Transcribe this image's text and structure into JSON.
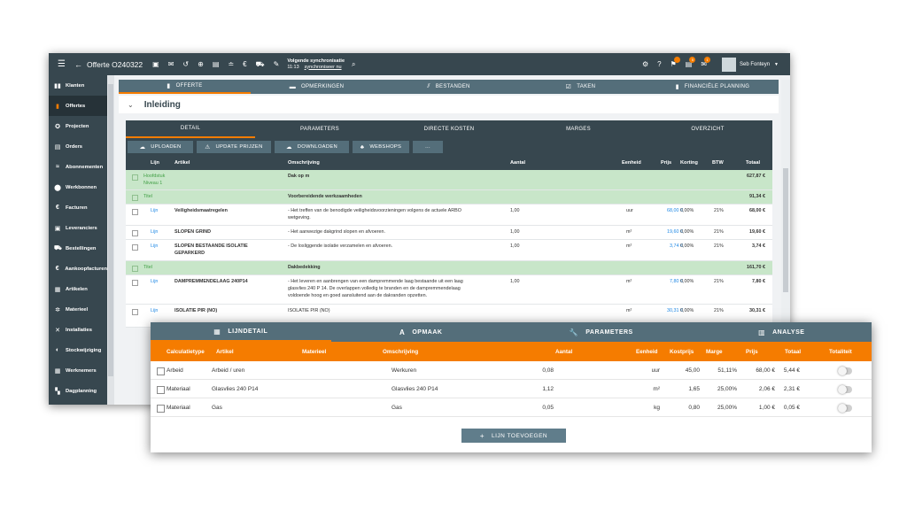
{
  "topbar": {
    "title": "Offerte O240322",
    "sync_title": "Volgende synchronisatie",
    "sync_time": "11:13",
    "sync_link": "synchroniseer nu",
    "user": "Seb Fonteyn",
    "badges": [
      "",
      "5",
      "1"
    ]
  },
  "sidebar": {
    "items": [
      {
        "label": "Klanten",
        "icon": "contacts-icon",
        "glyph": "▮▮"
      },
      {
        "label": "Offertes",
        "icon": "document-icon",
        "glyph": "▮"
      },
      {
        "label": "Projecten",
        "icon": "projects-icon",
        "glyph": "✪"
      },
      {
        "label": "Orders",
        "icon": "orders-icon",
        "glyph": "▤"
      },
      {
        "label": "Abonnementen",
        "icon": "subscriptions-icon",
        "glyph": "≈"
      },
      {
        "label": "Werkbonnen",
        "icon": "workorder-icon",
        "glyph": "⬤"
      },
      {
        "label": "Facturen",
        "icon": "euro-icon",
        "glyph": "€"
      },
      {
        "label": "Leveranciers",
        "icon": "supplier-icon",
        "glyph": "▣"
      },
      {
        "label": "Bestellingen",
        "icon": "cart-icon",
        "glyph": "⛟"
      },
      {
        "label": "Aankoopfacturen",
        "icon": "purchase-invoice-icon",
        "glyph": "€"
      },
      {
        "label": "Artikelen",
        "icon": "article-icon",
        "glyph": "▦"
      },
      {
        "label": "Materieel",
        "icon": "equipment-icon",
        "glyph": "✲"
      },
      {
        "label": "Installaties",
        "icon": "tools-icon",
        "glyph": "✕"
      },
      {
        "label": "Stockwijziging",
        "icon": "stock-icon",
        "glyph": "◐"
      },
      {
        "label": "Werknemers",
        "icon": "employees-icon",
        "glyph": "▦"
      },
      {
        "label": "Dagplanning",
        "icon": "planning-icon",
        "glyph": "▚"
      }
    ]
  },
  "main_tabs": [
    {
      "label": "OFFERTE",
      "icon": "document-icon",
      "glyph": "▮"
    },
    {
      "label": "OPMERKINGEN",
      "icon": "comment-icon",
      "glyph": "▬"
    },
    {
      "label": "BESTANDEN",
      "icon": "paperclip-icon",
      "glyph": "⫽"
    },
    {
      "label": "TAKEN",
      "icon": "checkbox-icon",
      "glyph": "☑"
    },
    {
      "label": "FINANCIËLE PLANNING",
      "icon": "finance-icon",
      "glyph": "▮"
    }
  ],
  "section": {
    "title": "Inleiding"
  },
  "sub_tabs": [
    "DETAIL",
    "PARAMETERS",
    "DIRECTE KOSTEN",
    "MARGES",
    "OVERZICHT"
  ],
  "actions": [
    {
      "label": "UPLOADEN",
      "icon": "cloud-upload-icon",
      "glyph": "☁"
    },
    {
      "label": "UPDATE PRIJZEN",
      "icon": "warning-icon",
      "glyph": "⚠"
    },
    {
      "label": "DOWNLOADEN",
      "icon": "cloud-download-icon",
      "glyph": "☁"
    },
    {
      "label": "WEBSHOPS",
      "icon": "basket-icon",
      "glyph": "♣"
    },
    {
      "label": "...",
      "icon": "more-icon",
      "glyph": ""
    }
  ],
  "table": {
    "headers": {
      "lijn": "Lijn",
      "artikel": "Artikel",
      "omschrijving": "Omschrijving",
      "aantal": "Aantal",
      "eenheid": "Eenheid",
      "prijs": "Prijs",
      "korting": "Korting",
      "btw": "BTW",
      "totaal": "Totaal"
    },
    "rows": [
      {
        "kind": "green",
        "type": "Hoofdstuk",
        "type2": "Niveau 1",
        "artikel": "",
        "omschrijving": "Dak op m",
        "omschrijving2": "",
        "aantal": "",
        "eenheid": "",
        "prijs": "",
        "korting": "",
        "btw": "",
        "totaal": "627,87 €"
      },
      {
        "kind": "green",
        "type": "Titel",
        "type2": "",
        "artikel": "",
        "omschrijving": "Voorbereidende werkzaamheden",
        "omschrijving2": "",
        "aantal": "",
        "eenheid": "",
        "prijs": "",
        "korting": "",
        "btw": "",
        "totaal": "91,34 €"
      },
      {
        "kind": "line",
        "type": "Lijn",
        "type2": "",
        "artikel": "Veiligheidsmaatregelen",
        "artikel2": "",
        "omschrijving": "- Het treffen van de benodigde veiligheidsvoorzieningen volgens de actuele ARBO",
        "omschrijving2": "wetgeving.",
        "aantal": "1,00",
        "eenheid": "uur",
        "prijs": "68,00 €",
        "korting": "0,00%",
        "btw": "21%",
        "totaal": "68,00 €"
      },
      {
        "kind": "line",
        "type": "Lijn",
        "type2": "",
        "artikel": "SLOPEN GRIND",
        "artikel2": "",
        "omschrijving": "- Het aanwezige dakgrind slopen en afvoeren.",
        "omschrijving2": "",
        "aantal": "1,00",
        "eenheid": "m²",
        "prijs": "19,60 €",
        "korting": "0,00%",
        "btw": "21%",
        "totaal": "19,60 €"
      },
      {
        "kind": "line",
        "type": "Lijn",
        "type2": "",
        "artikel": "SLOPEN BESTAANDE ISOLATIE",
        "artikel2": "GEPARKERD",
        "omschrijving": "- De losliggende isolatie verzamelen en afvoeren.",
        "omschrijving2": "",
        "aantal": "1,00",
        "eenheid": "m²",
        "prijs": "3,74 €",
        "korting": "0,00%",
        "btw": "21%",
        "totaal": "3,74 €"
      },
      {
        "kind": "green",
        "type": "Titel",
        "type2": "",
        "artikel": "",
        "omschrijving": "Dakbedekking",
        "omschrijving2": "",
        "aantal": "",
        "eenheid": "",
        "prijs": "",
        "korting": "",
        "btw": "",
        "totaal": "161,70 €"
      },
      {
        "kind": "line",
        "type": "Lijn",
        "type2": "",
        "artikel": "DAMPREMMENDELAAG 240P14",
        "artikel2": "",
        "omschrijving": "- Het leveren en aanbrengen van een dampremmende laag bestaande uit een laag",
        "omschrijving2": "glasvlies 240 P 14. De overlappen volledig te branden en de dampremmendelaag",
        "omschrijving3": "voldoende hoog en goed aansluitend aan de dakranden opzetten.",
        "aantal": "1,00",
        "eenheid": "m²",
        "prijs": "7,80 €",
        "korting": "0,00%",
        "btw": "21%",
        "totaal": "7,80 €"
      },
      {
        "kind": "line",
        "type": "Lijn",
        "type2": "",
        "artikel": "ISOLATIE PIR (NO)",
        "artikel2": "",
        "omschrijving": "ISOLATIE PIR (NO)",
        "omschrijving2": "",
        "aantal": "",
        "eenheid": "m²",
        "prijs": "30,31 €",
        "korting": "0,00%",
        "btw": "21%",
        "totaal": "30,31 €"
      }
    ]
  },
  "panel": {
    "tabs": [
      {
        "label": "LIJNDETAIL",
        "icon": "grid-icon",
        "glyph": "▦"
      },
      {
        "label": "OPMAAK",
        "icon": "text-format-icon",
        "glyph": "A"
      },
      {
        "label": "PARAMETERS",
        "icon": "wrench-icon",
        "glyph": "🔧"
      },
      {
        "label": "ANALYSE",
        "icon": "chart-icon",
        "glyph": "▥"
      }
    ],
    "headers": {
      "type": "Calculatietype",
      "artikel": "Artikel",
      "materieel": "Materieel",
      "omschrijving": "Omschrijving",
      "aantal": "Aantal",
      "eenheid": "Eenheid",
      "kostprijs": "Kostprijs",
      "marge": "Marge",
      "prijs": "Prijs",
      "totaal": "Totaal",
      "totaliteit": "Totaliteit"
    },
    "rows": [
      {
        "type": "Arbeid",
        "artikel": "Arbeid / uren",
        "omschrijving": "Werkuren",
        "aantal": "0,08",
        "eenheid": "uur",
        "kostprijs": "45,00",
        "marge": "51,11%",
        "prijs": "68,00 €",
        "totaal": "5,44 €"
      },
      {
        "type": "Materiaal",
        "artikel": "Glasvlies 240 P14",
        "omschrijving": "Glasvlies 240 P14",
        "aantal": "1,12",
        "eenheid": "m²",
        "kostprijs": "1,65",
        "marge": "25,00%",
        "prijs": "2,06 €",
        "totaal": "2,31 €"
      },
      {
        "type": "Materiaal",
        "artikel": "Gas",
        "omschrijving": "Gas",
        "aantal": "0,05",
        "eenheid": "kg",
        "kostprijs": "0,80",
        "marge": "25,00%",
        "prijs": "1,00 €",
        "totaal": "0,05 €"
      }
    ],
    "add_button": "LIJN TOEVOEGEN"
  },
  "colors": {
    "dark": "#37474f",
    "mid": "#546e7a",
    "accent": "#f57c00",
    "green_row": "#c8e6c9"
  }
}
